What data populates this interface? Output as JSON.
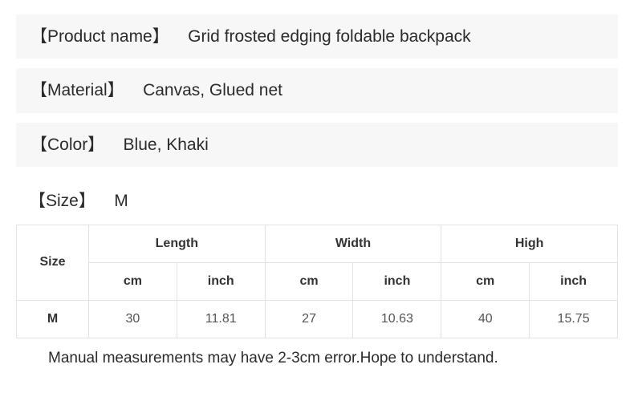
{
  "product_name": {
    "label": "【Product name】",
    "value": "Grid frosted edging foldable backpack"
  },
  "material": {
    "label": "【Material】",
    "value": "Canvas, Glued net"
  },
  "color": {
    "label": "【Color】",
    "value": "Blue, Khaki"
  },
  "size_header": {
    "label": "【Size】",
    "value": "M"
  },
  "table": {
    "size_col": "Size",
    "groups": [
      {
        "name": "Length",
        "units": [
          "cm",
          "inch"
        ]
      },
      {
        "name": "Width",
        "units": [
          "cm",
          "inch"
        ]
      },
      {
        "name": "High",
        "units": [
          "cm",
          "inch"
        ]
      }
    ],
    "rows": [
      {
        "size": "M",
        "values": [
          "30",
          "11.81",
          "27",
          "10.63",
          "40",
          "15.75"
        ]
      }
    ]
  },
  "note": "Manual measurements may have 2-3cm error.Hope to understand."
}
